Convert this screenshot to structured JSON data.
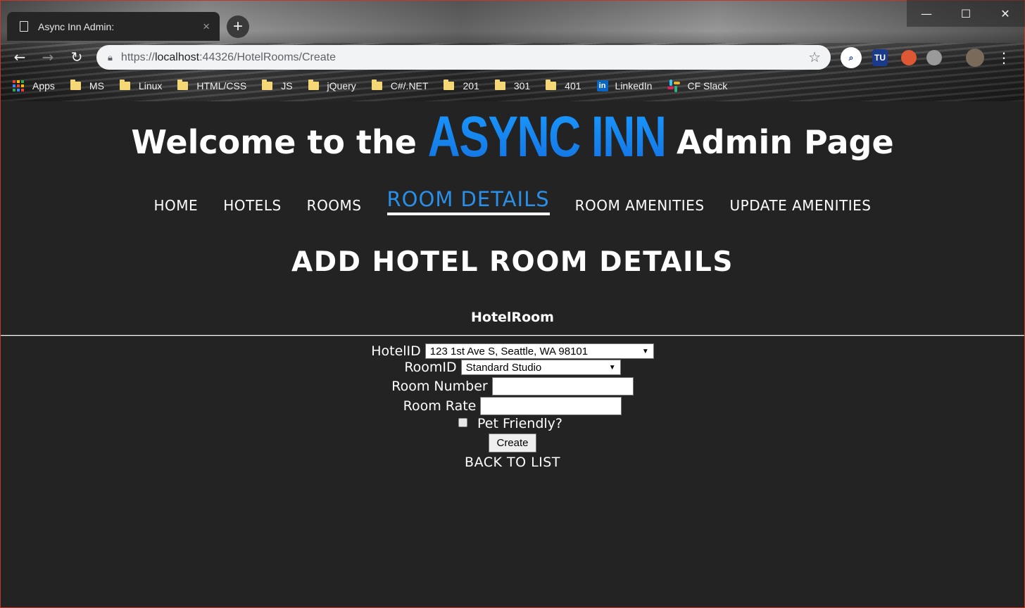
{
  "browser": {
    "tab_title": "Async Inn Admin:",
    "tab_close": "×",
    "new_tab": "+",
    "url_scheme": "https://",
    "url_host": "localhost",
    "url_path": ":44326/HotelRooms/Create",
    "window_controls": {
      "minimize": "—",
      "maximize": "☐",
      "close": "✕"
    },
    "nav": {
      "back": "←",
      "forward": "→",
      "reload": "↻"
    },
    "extensions": [
      {
        "name": "search-extension-icon",
        "label": "",
        "color": "#ffffff"
      },
      {
        "name": "tu-extension-icon",
        "label": "TU",
        "color": "#1a3a8c"
      },
      {
        "name": "duckduckgo-icon",
        "label": "",
        "color": "#de5833"
      },
      {
        "name": "gray-extension-icon",
        "label": "",
        "color": "#9a9a9a"
      }
    ],
    "bookmarks": [
      {
        "label": "Apps",
        "icon": "apps-grid-icon"
      },
      {
        "label": "MS",
        "icon": "folder-icon"
      },
      {
        "label": "Linux",
        "icon": "folder-icon"
      },
      {
        "label": "HTML/CSS",
        "icon": "folder-icon"
      },
      {
        "label": "JS",
        "icon": "folder-icon"
      },
      {
        "label": "jQuery",
        "icon": "folder-icon"
      },
      {
        "label": "C#/.NET",
        "icon": "folder-icon"
      },
      {
        "label": "201",
        "icon": "folder-icon"
      },
      {
        "label": "301",
        "icon": "folder-icon"
      },
      {
        "label": "401",
        "icon": "folder-icon"
      },
      {
        "label": "LinkedIn",
        "icon": "linkedin-icon"
      },
      {
        "label": "CF Slack",
        "icon": "slack-icon"
      }
    ]
  },
  "header": {
    "welcome_prefix": "Welcome to the",
    "brand": "ASYNC INN",
    "welcome_suffix": "Admin Page",
    "accent_color": "#1e88f0"
  },
  "nav": {
    "items": [
      {
        "label": "HOME",
        "active": false
      },
      {
        "label": "HOTELS",
        "active": false
      },
      {
        "label": "ROOMS",
        "active": false
      },
      {
        "label": "ROOM DETAILS",
        "active": true
      },
      {
        "label": "ROOM AMENITIES",
        "active": false
      },
      {
        "label": "UPDATE AMENITIES",
        "active": false
      }
    ]
  },
  "main": {
    "heading": "ADD HOTEL ROOM DETAILS",
    "section_label": "HotelRoom",
    "form": {
      "hotel_id_label": "HotelID",
      "hotel_id_value": "123 1st Ave S, Seattle, WA 98101",
      "room_id_label": "RoomID",
      "room_id_value": "Standard Studio",
      "room_number_label": "Room Number",
      "room_number_value": "",
      "room_rate_label": "Room Rate",
      "room_rate_value": "",
      "pet_friendly_label": "Pet Friendly?",
      "pet_friendly_checked": false,
      "create_label": "Create"
    },
    "back_link": "BACK TO LIST"
  }
}
